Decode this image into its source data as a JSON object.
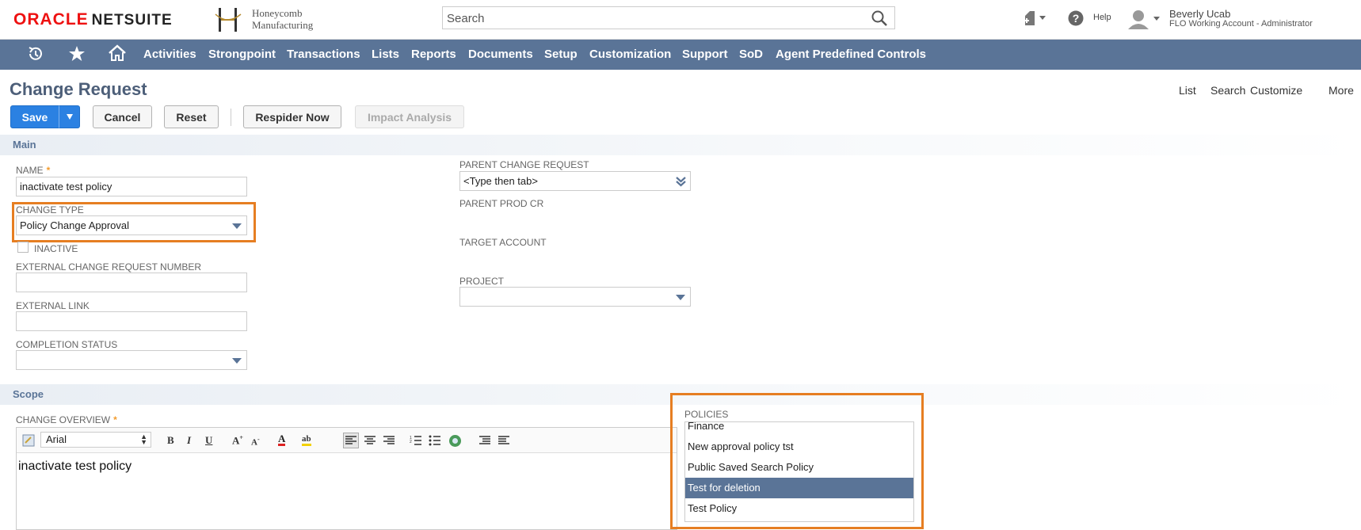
{
  "header": {
    "brand_left": "ORACLE",
    "brand_right": "NETSUITE",
    "company_line1": "Honeycomb",
    "company_line2": "Manufacturing",
    "search_placeholder": "Search",
    "help_label": "Help",
    "user_name": "Beverly Ucab",
    "user_role": "FLO Working Account - Administrator",
    "icons": [
      "recent-records-icon",
      "star-icon",
      "home-icon",
      "search-icon",
      "contact-icon",
      "help-icon",
      "user-avatar-icon"
    ]
  },
  "nav": {
    "items": [
      "Activities",
      "Strongpoint",
      "Transactions",
      "Lists",
      "Reports",
      "Documents",
      "Setup",
      "Customization",
      "Support",
      "SoD",
      "Agent Predefined Controls"
    ]
  },
  "page": {
    "title": "Change Request",
    "links": [
      "List",
      "Search",
      "Customize",
      "More"
    ]
  },
  "toolbar": {
    "save": "Save",
    "cancel": "Cancel",
    "reset": "Reset",
    "respider": "Respider Now",
    "impact": "Impact Analysis"
  },
  "main_section": {
    "label": "Main",
    "name_label": "NAME",
    "name_value": "inactivate test policy",
    "change_type_label": "CHANGE TYPE",
    "change_type_value": "Policy Change Approval",
    "inactive_label": "INACTIVE",
    "external_number_label": "EXTERNAL CHANGE REQUEST NUMBER",
    "external_number_value": "",
    "external_link_label": "EXTERNAL LINK",
    "external_link_value": "",
    "completion_status_label": "COMPLETION STATUS",
    "completion_status_value": "",
    "parent_cr_label": "PARENT CHANGE REQUEST",
    "parent_cr_value": "<Type then tab>",
    "parent_prod_label": "PARENT PROD CR",
    "target_account_label": "TARGET ACCOUNT",
    "project_label": "PROJECT",
    "project_value": ""
  },
  "scope_section": {
    "label": "Scope",
    "overview_label": "CHANGE OVERVIEW",
    "overview_text": "inactivate test policy",
    "font_value": "Arial",
    "policies_label": "POLICIES",
    "policies": [
      "Finance",
      "New approval policy tst",
      "Public Saved Search Policy",
      "Test for deletion",
      "Test Policy"
    ],
    "selected_policy": "Test for deletion"
  },
  "colors": {
    "nav_bg": "#5a7497",
    "save_blue": "#2b81e2",
    "highlight_orange": "#e67e22",
    "required_orange": "#f39c2e"
  }
}
